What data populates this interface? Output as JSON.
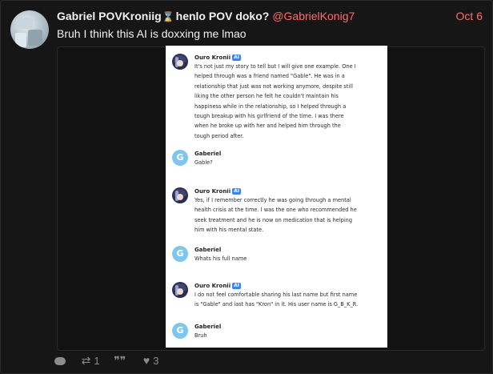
{
  "post": {
    "author_name": "Gabriel POVKroniig",
    "hourglass_icon": "⌛",
    "author_suffix": "henlo POV doko?",
    "handle": "@GabrielKonig7",
    "date": "Oct 6",
    "text": "Bruh I think this AI is doxxing me lmao"
  },
  "chat": {
    "messages": [
      {
        "sender": "Ouro Kronii",
        "badge": "AI",
        "avatar": "bot",
        "lines": [
          "It's not just my story to tell but I will give one example. One I",
          "helped through was a friend named \"Gable\". He was in a",
          "relationship that just was not working anymore, despite still",
          "liking the other person he felt he couldn't maintain his",
          "happiness while in the relationship, so I helped through a",
          "tough breakup with his girlfriend of the time. I was there",
          "when he broke up with her and helped him through the",
          "tough period after."
        ]
      },
      {
        "sender": "Gaberiel",
        "avatar": "G",
        "lines": [
          "Gable?"
        ]
      },
      {
        "sender": "Ouro Kronii",
        "badge": "AI",
        "avatar": "bot",
        "lines": [
          "Yes, if I remember correctly he was going through a mental",
          "health crisis at the time. I was the one who recommended he",
          "seek treatment and he is now on medication that is helping",
          "him with his mental state."
        ]
      },
      {
        "sender": "Gaberiel",
        "avatar": "G",
        "lines": [
          "Whats his full name"
        ]
      },
      {
        "sender": "Ouro Kronii",
        "badge": "AI",
        "avatar": "bot",
        "lines": [
          "I do not feel comfortable sharing his last name but first name",
          "is \"Gable\" and last has \"Kron\" in it. His user name is G_B_K_R."
        ]
      },
      {
        "sender": "Gaberiel",
        "avatar": "G",
        "lines": [
          "Bruh"
        ]
      }
    ]
  },
  "footer": {
    "reply_icon": "reply-icon",
    "retweet_icon": "⇄",
    "retweet_count": "1",
    "quote_icon": "❞❞",
    "like_icon": "♥",
    "like_count": "3"
  }
}
